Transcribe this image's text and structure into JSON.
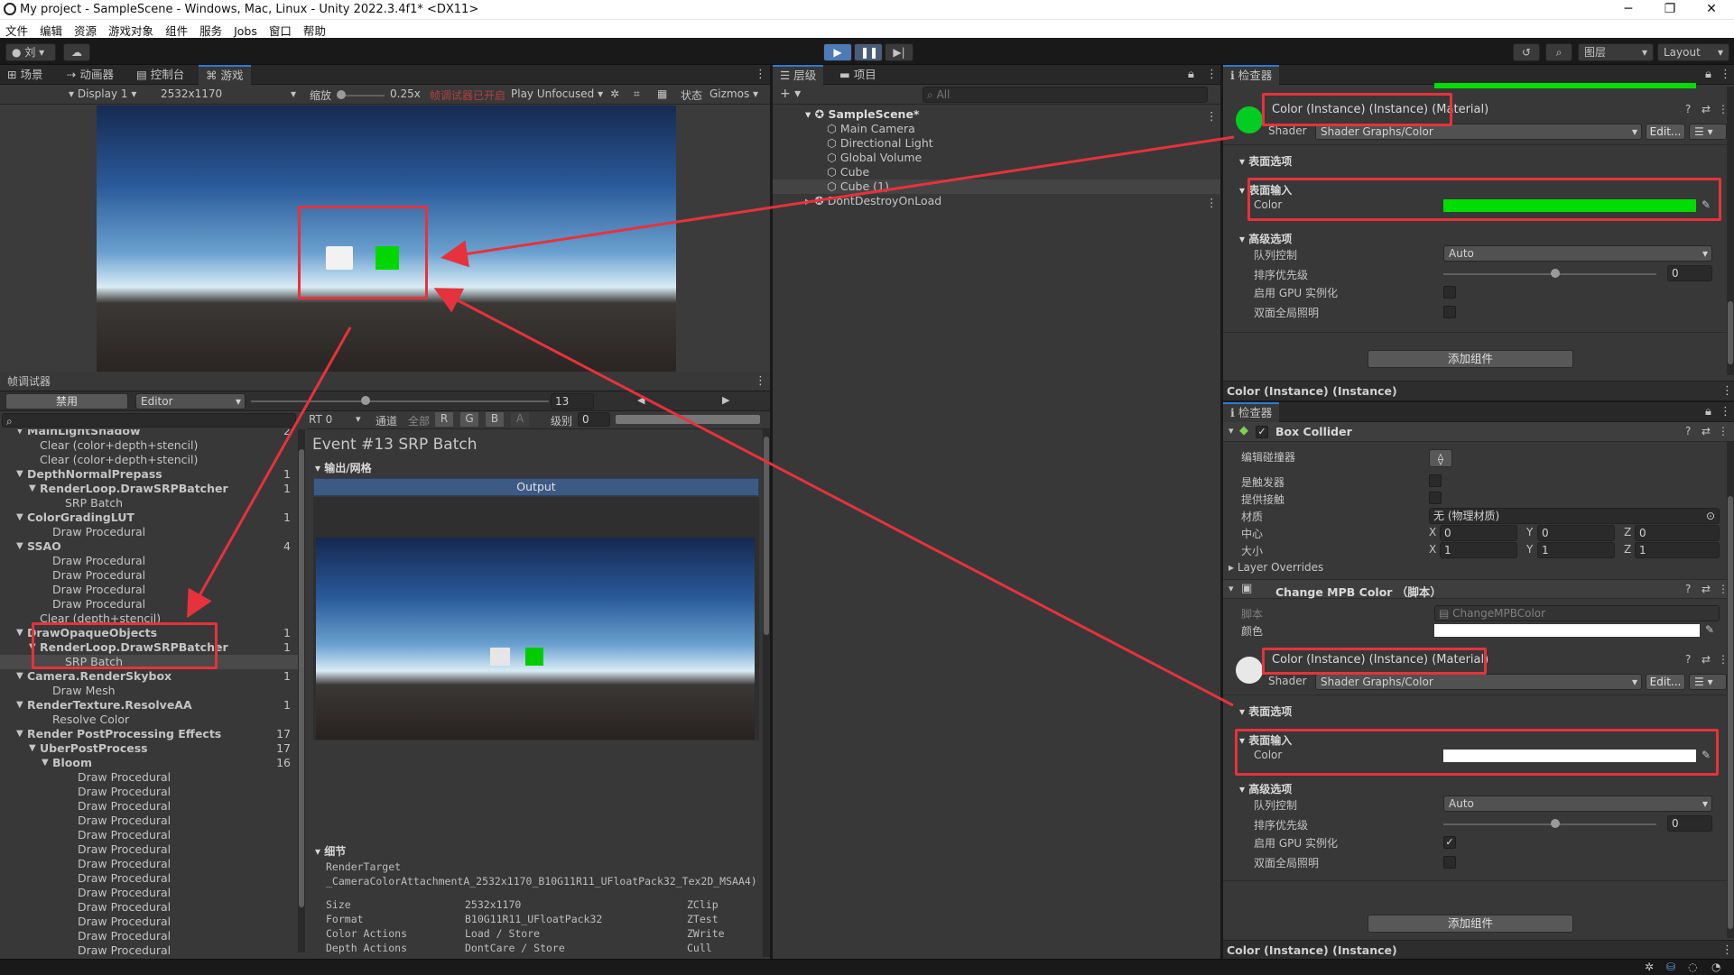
{
  "window": {
    "title": "My project - SampleScene - Windows, Mac, Linux - Unity 2022.3.4f1* <DX11>"
  },
  "menu": [
    "文件",
    "编辑",
    "资源",
    "游戏对象",
    "组件",
    "服务",
    "Jobs",
    "窗口",
    "帮助"
  ],
  "toolbar": {
    "account": "刘",
    "layers": "图层",
    "layout": "Layout"
  },
  "scene_view": {
    "tabs": [
      "场景",
      "动画器",
      "控制台",
      "游戏"
    ],
    "display": "Display 1",
    "resolution": "2532x1170",
    "scale_label": "缩放",
    "scale_value": "0.25x",
    "debug_note": "帧调试器已开启",
    "play_mode": "Play Unfocused",
    "stats": "状态",
    "gizmos": "Gizmos"
  },
  "hierarchy": {
    "tabs": [
      "层级",
      "项目"
    ],
    "search_placeholder": "All",
    "scene": "SampleScene*",
    "items": [
      "Main Camera",
      "Directional Light",
      "Global Volume",
      "Cube",
      "Cube (1)"
    ],
    "dont_destroy": "DontDestroyOnLoad"
  },
  "frame_debugger": {
    "title": "帧调试器",
    "disable_btn": "禁用",
    "target": "Editor",
    "event_number": "13",
    "rt": "RT 0",
    "channels_label": "通道",
    "channels": [
      "全部",
      "R",
      "G",
      "B",
      "A"
    ],
    "level_label": "级别",
    "level_value": "0",
    "event_title": "Event #13 SRP Batch",
    "output_section": "输出/网格",
    "output_btn": "Output",
    "details_section": "细节",
    "render_target_label": "RenderTarget",
    "render_target_value": "_CameraColorAttachmentA_2532x1170_B10G11R11_UFloatPack32_Tex2D_MSAA4)",
    "details": [
      {
        "k": "Size",
        "v": "2532x1170",
        "r": "ZClip"
      },
      {
        "k": "Format",
        "v": "B10G11R11_UFloatPack32",
        "r": "ZTest"
      },
      {
        "k": "Color Actions",
        "v": "Load / Store",
        "r": "ZWrite"
      },
      {
        "k": "Depth Actions",
        "v": "DontCare / Store",
        "r": "Cull"
      }
    ],
    "tree": [
      {
        "t": "MainLightShadow",
        "i": 1,
        "b": true,
        "n": "2"
      },
      {
        "t": "Clear (color+depth+stencil)",
        "i": 1,
        "b": false,
        "n": ""
      },
      {
        "t": "Clear (color+depth+stencil)",
        "i": 1,
        "b": false,
        "n": ""
      },
      {
        "t": "DepthNormalPrepass",
        "i": 1,
        "b": true,
        "n": "1"
      },
      {
        "t": "RenderLoop.DrawSRPBatcher",
        "i": 2,
        "b": true,
        "n": "1"
      },
      {
        "t": "SRP Batch",
        "i": 3,
        "b": false,
        "n": ""
      },
      {
        "t": "ColorGradingLUT",
        "i": 1,
        "b": true,
        "n": "1"
      },
      {
        "t": "Draw Procedural",
        "i": 2,
        "b": false,
        "n": ""
      },
      {
        "t": "SSAO",
        "i": 1,
        "b": true,
        "n": "4"
      },
      {
        "t": "Draw Procedural",
        "i": 2,
        "b": false,
        "n": ""
      },
      {
        "t": "Draw Procedural",
        "i": 2,
        "b": false,
        "n": ""
      },
      {
        "t": "Draw Procedural",
        "i": 2,
        "b": false,
        "n": ""
      },
      {
        "t": "Draw Procedural",
        "i": 2,
        "b": false,
        "n": ""
      },
      {
        "t": "Clear (depth+stencil)",
        "i": 1,
        "b": false,
        "n": ""
      },
      {
        "t": "DrawOpaqueObjects",
        "i": 1,
        "b": true,
        "n": "1"
      },
      {
        "t": "RenderLoop.DrawSRPBatcher",
        "i": 2,
        "b": true,
        "n": "1"
      },
      {
        "t": "SRP Batch",
        "i": 3,
        "b": false,
        "n": "",
        "sel": true
      },
      {
        "t": "Camera.RenderSkybox",
        "i": 1,
        "b": true,
        "n": "1"
      },
      {
        "t": "Draw Mesh",
        "i": 2,
        "b": false,
        "n": ""
      },
      {
        "t": "RenderTexture.ResolveAA",
        "i": 1,
        "b": true,
        "n": "1"
      },
      {
        "t": "Resolve Color",
        "i": 2,
        "b": false,
        "n": ""
      },
      {
        "t": "Render PostProcessing Effects",
        "i": 1,
        "b": true,
        "n": "17"
      },
      {
        "t": "UberPostProcess",
        "i": 2,
        "b": true,
        "n": "17"
      },
      {
        "t": "Bloom",
        "i": 3,
        "b": true,
        "n": "16"
      },
      {
        "t": "Draw Procedural",
        "i": 4,
        "b": false,
        "n": ""
      },
      {
        "t": "Draw Procedural",
        "i": 4,
        "b": false,
        "n": ""
      },
      {
        "t": "Draw Procedural",
        "i": 4,
        "b": false,
        "n": ""
      },
      {
        "t": "Draw Procedural",
        "i": 4,
        "b": false,
        "n": ""
      },
      {
        "t": "Draw Procedural",
        "i": 4,
        "b": false,
        "n": ""
      },
      {
        "t": "Draw Procedural",
        "i": 4,
        "b": false,
        "n": ""
      },
      {
        "t": "Draw Procedural",
        "i": 4,
        "b": false,
        "n": ""
      },
      {
        "t": "Draw Procedural",
        "i": 4,
        "b": false,
        "n": ""
      },
      {
        "t": "Draw Procedural",
        "i": 4,
        "b": false,
        "n": ""
      },
      {
        "t": "Draw Procedural",
        "i": 4,
        "b": false,
        "n": ""
      },
      {
        "t": "Draw Procedural",
        "i": 4,
        "b": false,
        "n": ""
      },
      {
        "t": "Draw Procedural",
        "i": 4,
        "b": false,
        "n": ""
      },
      {
        "t": "Draw Procedural",
        "i": 4,
        "b": false,
        "n": ""
      }
    ]
  },
  "inspector_top": {
    "tab": "检查器",
    "material_title": "Color (Instance) (Instance) (Material)",
    "shader_label": "Shader",
    "shader_value": "Shader Graphs/Color",
    "edit_btn": "Edit...",
    "surface_options": "表面选项",
    "surface_inputs": "表面输入",
    "color_label": "Color",
    "color_value": "#00dd00",
    "advanced": "高级选项",
    "queue_label": "队列控制",
    "queue_value": "Auto",
    "priority_label": "排序优先级",
    "priority_value": "0",
    "gpu_instancing": "启用 GPU 实例化",
    "double_sided_gi": "双面全局照明",
    "add_component": "添加组件",
    "footer": "Color (Instance) (Instance)"
  },
  "inspector_bottom": {
    "tab": "检查器",
    "box_collider": "Box Collider",
    "edit_collider": "编辑碰撞器",
    "is_trigger": "是触发器",
    "provides_contacts": "提供接触",
    "material_label": "材质",
    "material_value": "无 (物理材质)",
    "center_label": "中心",
    "size_label": "大小",
    "center": [
      "0",
      "0",
      "0"
    ],
    "size": [
      "1",
      "1",
      "1"
    ],
    "axes": [
      "X",
      "Y",
      "Z"
    ],
    "layer_overrides": "Layer Overrides",
    "script_component": "Change MPB Color （脚本）",
    "script_label": "脚本",
    "script_value": "ChangeMPBColor",
    "color_label_cn": "颜色",
    "material_title": "Color (Instance) (Instance) (Material)",
    "shader_label": "Shader",
    "shader_value": "Shader Graphs/Color",
    "edit_btn": "Edit...",
    "surface_options": "表面选项",
    "surface_inputs": "表面输入",
    "color_label": "Color",
    "color_value": "#ffffff",
    "advanced": "高级选项",
    "queue_label": "队列控制",
    "queue_value": "Auto",
    "priority_label": "排序优先级",
    "priority_value": "0",
    "gpu_instancing": "启用 GPU 实例化",
    "double_sided_gi": "双面全局照明",
    "add_component": "添加组件",
    "footer": "Color (Instance) (Instance)"
  }
}
